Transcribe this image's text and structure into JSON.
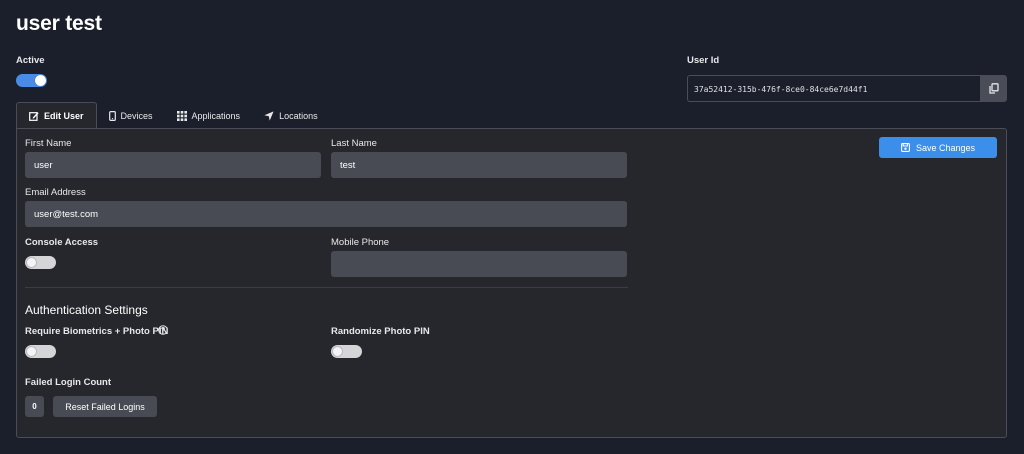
{
  "header": {
    "title": "user test"
  },
  "active": {
    "label": "Active",
    "on": true
  },
  "user_id": {
    "label": "User Id",
    "value": "37a52412-315b-476f-8ce0-84ce6e7d44f1"
  },
  "tabs": [
    {
      "label": "Edit User",
      "icon": "edit-icon",
      "active": true
    },
    {
      "label": "Devices",
      "icon": "mobile-icon"
    },
    {
      "label": "Applications",
      "icon": "grid-icon"
    },
    {
      "label": "Locations",
      "icon": "location-arrow-icon"
    }
  ],
  "form": {
    "first_name": {
      "label": "First Name",
      "value": "user"
    },
    "last_name": {
      "label": "Last Name",
      "value": "test"
    },
    "email": {
      "label": "Email Address",
      "value": "user@test.com"
    },
    "console_access": {
      "label": "Console Access",
      "on": false
    },
    "mobile_phone": {
      "label": "Mobile Phone",
      "value": ""
    },
    "save_label": "Save Changes"
  },
  "auth": {
    "title": "Authentication Settings",
    "biometrics": {
      "label": "Require Biometrics + Photo PIN",
      "on": false
    },
    "randomize": {
      "label": "Randomize Photo PIN",
      "on": false
    },
    "failed_login": {
      "label": "Failed Login Count",
      "count": "0",
      "reset_label": "Reset Failed Logins"
    }
  },
  "colors": {
    "accent": "#3b8eea",
    "background": "#1b1f2b",
    "panel": "#25272d",
    "input": "#494b54"
  }
}
